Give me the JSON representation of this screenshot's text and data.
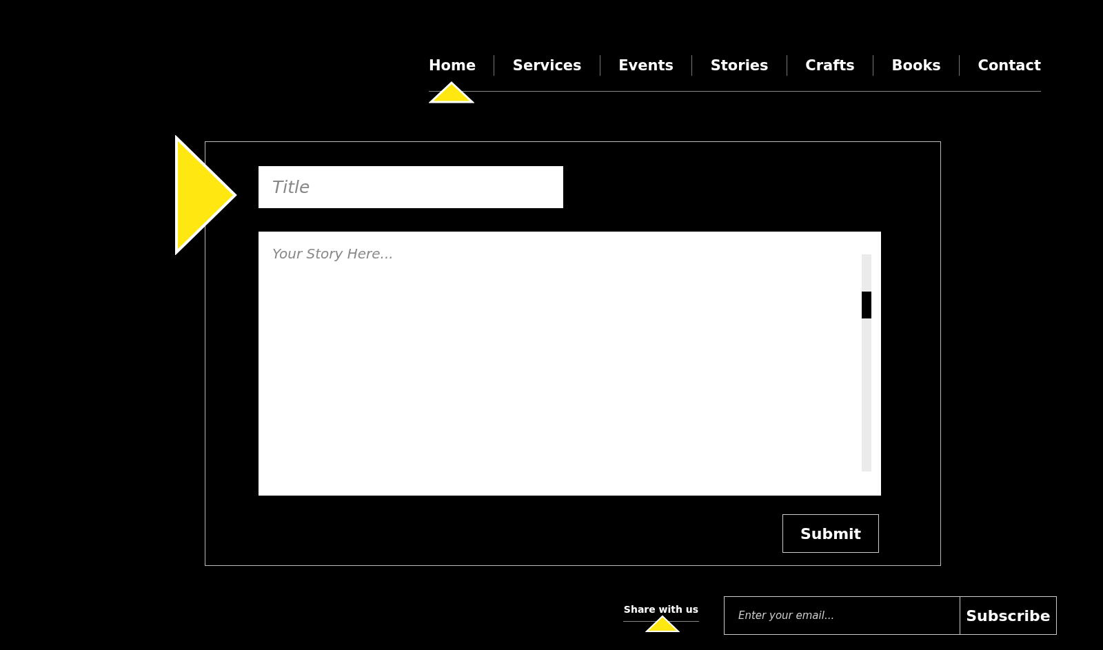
{
  "nav": {
    "items": [
      {
        "label": "Home",
        "selected": true
      },
      {
        "label": "Services",
        "selected": false
      },
      {
        "label": "Events",
        "selected": false
      },
      {
        "label": "Stories",
        "selected": false
      },
      {
        "label": "Crafts",
        "selected": false
      },
      {
        "label": "Books",
        "selected": false
      },
      {
        "label": "Contact",
        "selected": false
      }
    ]
  },
  "story_form": {
    "title": {
      "placeholder": "Title"
    },
    "story": {
      "placeholder": "Your Story Here..."
    },
    "submit": "Submit"
  },
  "footer": {
    "share_label": "Share with us",
    "email": {
      "placeholder": "Enter your email..."
    },
    "subscribe": "Subscribe"
  }
}
